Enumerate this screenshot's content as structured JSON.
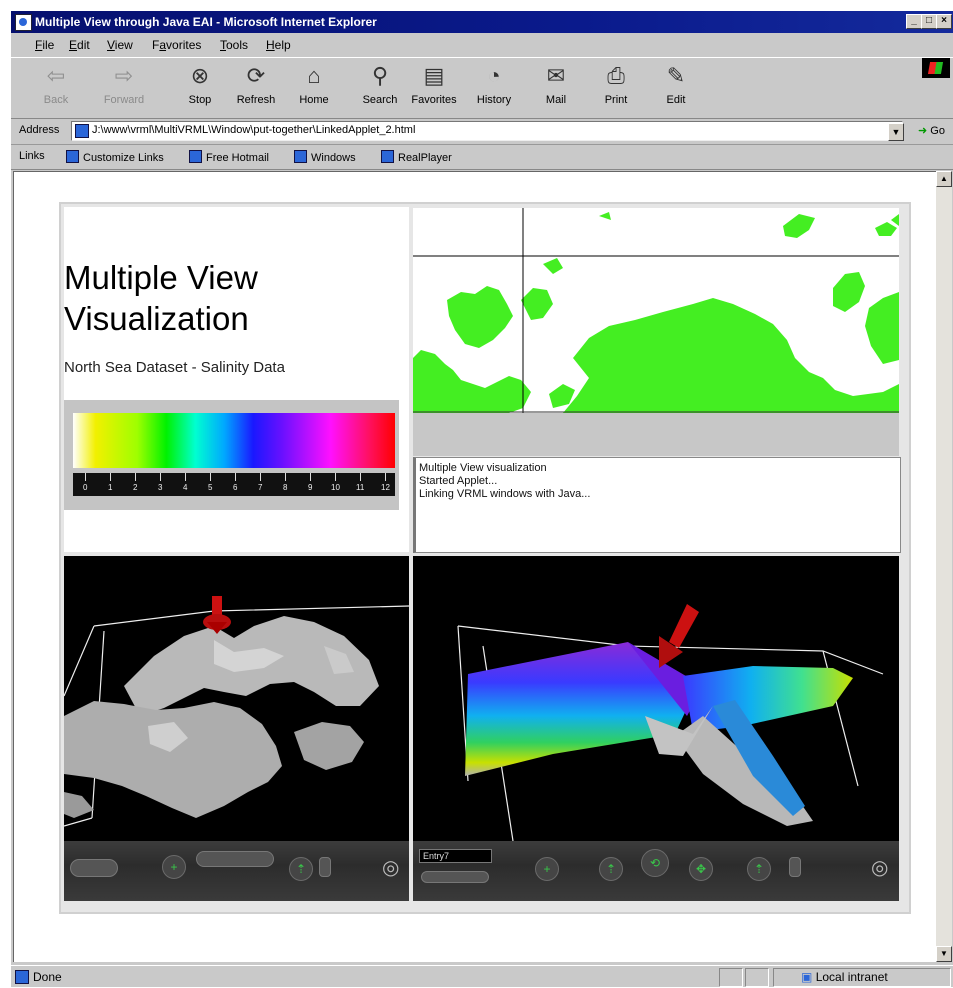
{
  "window": {
    "title": "Multiple View through Java EAI - Microsoft Internet Explorer",
    "controls": [
      "_",
      "□",
      "×"
    ]
  },
  "menu": [
    {
      "label": "File",
      "accel": "F",
      "rest": "ile"
    },
    {
      "label": "Edit",
      "accel": "E",
      "rest": "dit"
    },
    {
      "label": "View",
      "accel": "V",
      "rest": "iew"
    },
    {
      "label": "Favorites",
      "accel": "a",
      "pre": "F",
      "rest": "vorites"
    },
    {
      "label": "Tools",
      "accel": "T",
      "rest": "ools"
    },
    {
      "label": "Help",
      "accel": "H",
      "rest": "elp"
    }
  ],
  "toolbar": {
    "back": "Back",
    "forward": "Forward",
    "stop": "Stop",
    "refresh": "Refresh",
    "home": "Home",
    "search": "Search",
    "favorites": "Favorites",
    "history": "History",
    "mail": "Mail",
    "print": "Print",
    "edit": "Edit"
  },
  "address": {
    "label": "Address",
    "url": "J:\\www\\vrml\\MultiVRML\\Window\\put-together\\LinkedApplet_2.html",
    "go": "Go"
  },
  "links": {
    "label": "Links",
    "items": [
      "Customize Links",
      "Free Hotmail",
      "Windows",
      "RealPlayer"
    ]
  },
  "page": {
    "heading_line1": "Multiple View",
    "heading_line2": "Visualization",
    "subheading": "North Sea Dataset - Salinity Data",
    "scale_ticks": [
      "0",
      "1",
      "2",
      "3",
      "4",
      "5",
      "6",
      "7",
      "8",
      "9",
      "10",
      "11",
      "12"
    ],
    "console_lines": [
      "Multiple View visualization",
      "Started Applet...",
      "Linking VRML windows with Java..."
    ],
    "viewpoint_name": "Entry7"
  },
  "status": {
    "text": "Done",
    "zone": "Local intranet"
  },
  "colors": {
    "titlebar": "#0a1a8c",
    "chrome": "#c9c9c9",
    "land_green": "#44ee22",
    "marker_red": "#cc1111",
    "terrain_gray": "#b8b8b8"
  }
}
